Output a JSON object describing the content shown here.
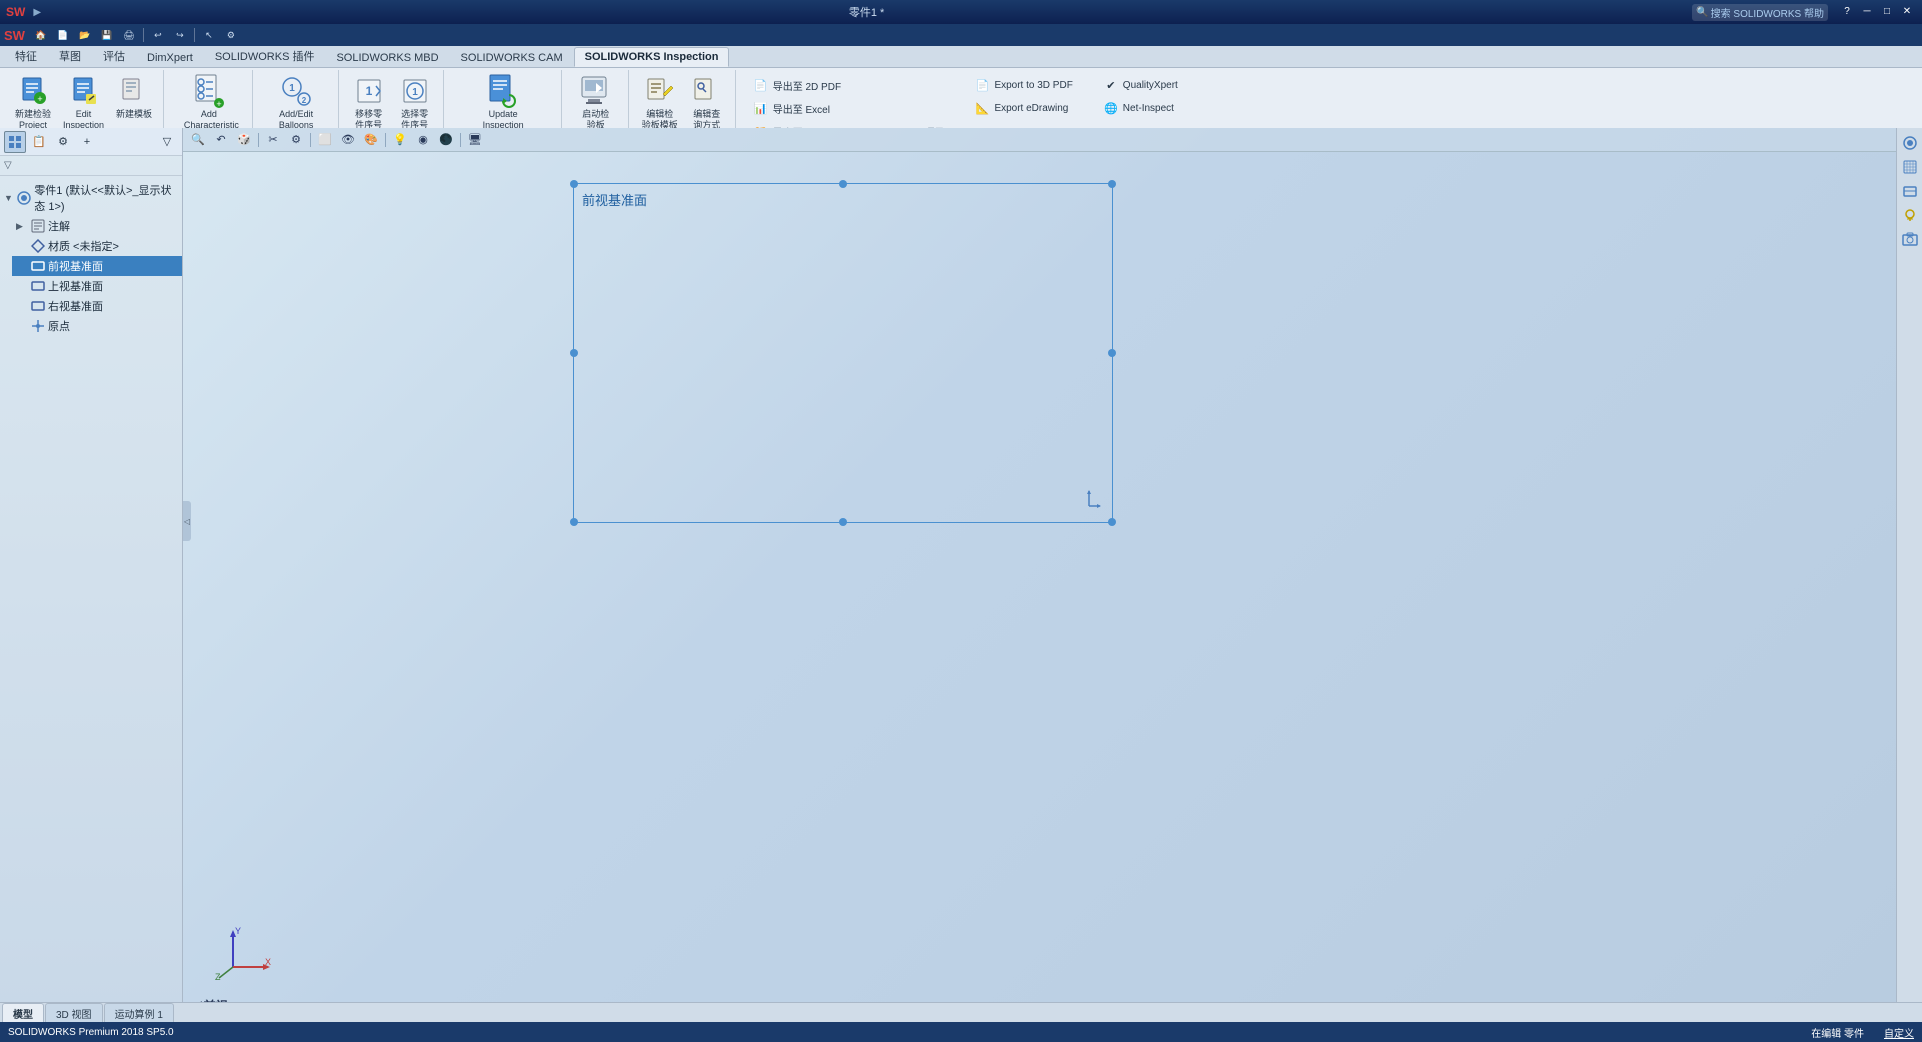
{
  "titlebar": {
    "title": "零件1 *",
    "minimize": "─",
    "maximize": "□",
    "close": "✕"
  },
  "quickaccess": {
    "buttons": [
      "SW",
      "🏠",
      "📄",
      "💾",
      "🖨",
      "↩",
      "▶"
    ]
  },
  "ribbontabs": {
    "tabs": [
      "特征",
      "草图",
      "评估",
      "DimXpert",
      "SOLIDWORKS 插件",
      "SOLIDWORKS MBD",
      "SOLIDWORKS CAM",
      "SOLIDWORKS Inspection"
    ]
  },
  "activetab": "SOLIDWORKS Inspection",
  "ribbon": {
    "groups": [
      {
        "name": "inspection-project-group",
        "buttons": [
          {
            "id": "new-inspection",
            "icon": "📋",
            "label": "新建\n检验\nProject"
          },
          {
            "id": "edit-inspection",
            "icon": "✏️",
            "label": "Edit\nInspection"
          },
          {
            "id": "new-build",
            "icon": "📄",
            "label": "新建模\n板"
          }
        ]
      },
      {
        "name": "add-char-group",
        "buttons": [
          {
            "id": "add-characteristic",
            "icon": "⊕",
            "label": "Add\nCharacteristic"
          }
        ]
      },
      {
        "name": "add-edit-balloons-group",
        "buttons": [
          {
            "id": "add-edit-balloons",
            "icon": "🔵",
            "label": "Add/Edit\nBalloons"
          }
        ]
      },
      {
        "name": "sequence-group",
        "buttons": [
          {
            "id": "move-seq",
            "icon": "↕",
            "label": "移移零\n件序号"
          },
          {
            "id": "select-seq",
            "icon": "◈",
            "label": "选择零\n件序号"
          }
        ]
      },
      {
        "name": "update-group",
        "buttons": [
          {
            "id": "update-inspection",
            "icon": "🔄",
            "label": "Update\nInspection\nProject"
          }
        ]
      },
      {
        "name": "launch-group",
        "buttons": [
          {
            "id": "launch-panel",
            "icon": "▶",
            "label": "启动检\n验板"
          }
        ]
      },
      {
        "name": "edit-template-group",
        "buttons": [
          {
            "id": "edit-template",
            "icon": "📝",
            "label": "编辑检\n验板模\n板"
          },
          {
            "id": "edit-query",
            "icon": "🔍",
            "label": "编辑查\n询方式"
          }
        ]
      }
    ],
    "submenus": {
      "left": [
        {
          "id": "export-2d-pdf",
          "label": "导出至 2D PDF",
          "icon": "📄",
          "enabled": true
        },
        {
          "id": "export-excel",
          "label": "导出至 Excel",
          "icon": "📊",
          "enabled": true
        },
        {
          "id": "export-sw-inspection",
          "label": "导出至 SOLIDWORKS Inspection 项目",
          "icon": "📁",
          "enabled": false
        }
      ],
      "right": [
        {
          "id": "export-3d-pdf",
          "label": "Export to 3D PDF",
          "icon": "📄",
          "enabled": true
        },
        {
          "id": "export-edrawing",
          "label": "Export eDrawing",
          "icon": "📐",
          "enabled": true
        }
      ],
      "rightplus": [
        {
          "id": "quality-xpert",
          "label": "QualityXpert",
          "icon": "✔",
          "enabled": true
        },
        {
          "id": "net-inspect",
          "label": "Net-Inspect",
          "icon": "🌐",
          "enabled": true
        }
      ]
    }
  },
  "viewtoolbar": {
    "buttons": [
      "🔍",
      "🔄",
      "📐",
      "🖼",
      "✏",
      "⬜",
      "●",
      "💡",
      "🎨",
      "🖥"
    ]
  },
  "featuretree": {
    "title": "零件1 (默认<<默认>_显示状态 1>)",
    "items": [
      {
        "id": "annotations",
        "label": "注解",
        "icon": "📝",
        "indent": 1,
        "expand": false
      },
      {
        "id": "materials",
        "label": "材质 <未指定>",
        "icon": "🔷",
        "indent": 1,
        "expand": false
      },
      {
        "id": "front-plane",
        "label": "前视基准面",
        "icon": "⬜",
        "indent": 1,
        "expand": false,
        "selected": true
      },
      {
        "id": "top-plane",
        "label": "上视基准面",
        "icon": "⬜",
        "indent": 1,
        "expand": false
      },
      {
        "id": "right-plane",
        "label": "右视基准面",
        "icon": "⬜",
        "indent": 1,
        "expand": false
      },
      {
        "id": "origin",
        "label": "原点",
        "icon": "⊕",
        "indent": 1,
        "expand": false
      }
    ]
  },
  "viewport": {
    "planelabel": "前视基准面",
    "viewlabel": "*前视"
  },
  "statusbar": {
    "left": "SOLIDWORKS Premium 2018 SP5.0",
    "editing": "在编辑 零件",
    "custom": "自定义"
  },
  "doctabs": {
    "tabs": [
      "模型",
      "3D 视图",
      "运动算例 1"
    ]
  },
  "rightpanel": {
    "buttons": [
      "⚙",
      "📐",
      "🔲",
      "📏",
      "📊"
    ]
  }
}
